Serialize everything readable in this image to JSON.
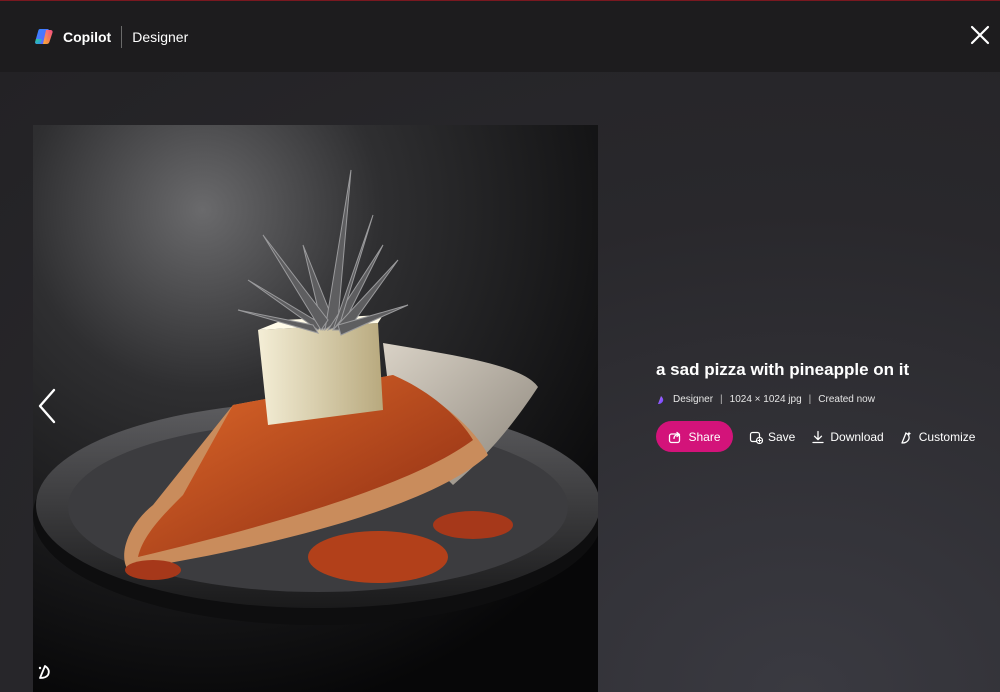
{
  "header": {
    "brand": "Copilot",
    "product": "Designer"
  },
  "image": {
    "alt": "a sad pizza with pineapple on it"
  },
  "details": {
    "title": "a sad pizza with pineapple on it",
    "meta": {
      "source": "Designer",
      "dimensions": "1024 × 1024 jpg",
      "created": "Created now"
    }
  },
  "actions": {
    "share": "Share",
    "save": "Save",
    "download": "Download",
    "customize": "Customize"
  },
  "colors": {
    "accent": "#d3137a",
    "background": "#1b1a1d",
    "header": "#1d1c1e"
  },
  "icons": [
    "copilot-logo-icon",
    "close-icon",
    "chevron-left-icon",
    "designer-icon",
    "share-icon",
    "save-icon",
    "download-icon",
    "customize-icon"
  ]
}
